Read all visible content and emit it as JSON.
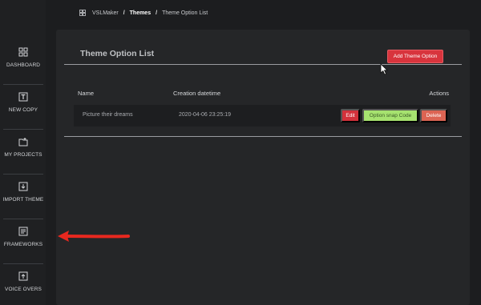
{
  "breadcrumb": {
    "icon": "grid-icon",
    "root": "VSLMaker",
    "section": "Themes",
    "current": "Theme Option List",
    "separator": "/"
  },
  "sidebar": {
    "items": [
      {
        "label": "DASHBOARD",
        "icon": "dashboard-icon"
      },
      {
        "label": "NEW COPY",
        "icon": "text-icon"
      },
      {
        "label": "MY PROJECTS",
        "icon": "folder-icon"
      },
      {
        "label": "IMPORT THEME",
        "icon": "import-icon"
      },
      {
        "label": "FRAMEWORKS",
        "icon": "document-icon"
      },
      {
        "label": "VOICE OVERS",
        "icon": "upload-icon"
      }
    ]
  },
  "page": {
    "title": "Theme Option List",
    "add_button": "Add Theme Option"
  },
  "table": {
    "headers": {
      "name": "Name",
      "date": "Creation datetime",
      "actions": "Actions"
    },
    "rows": [
      {
        "name": "Picture their dreams",
        "date": "2020-04-06 23:25:19",
        "edit": "Edit",
        "snap": "Option snap Code",
        "delete": "Delete"
      }
    ]
  },
  "colors": {
    "accent_red": "#d8343d",
    "snap_green": "#a6e26f",
    "delete_orange": "#dc6453",
    "annotation_arrow": "#e8281f"
  }
}
